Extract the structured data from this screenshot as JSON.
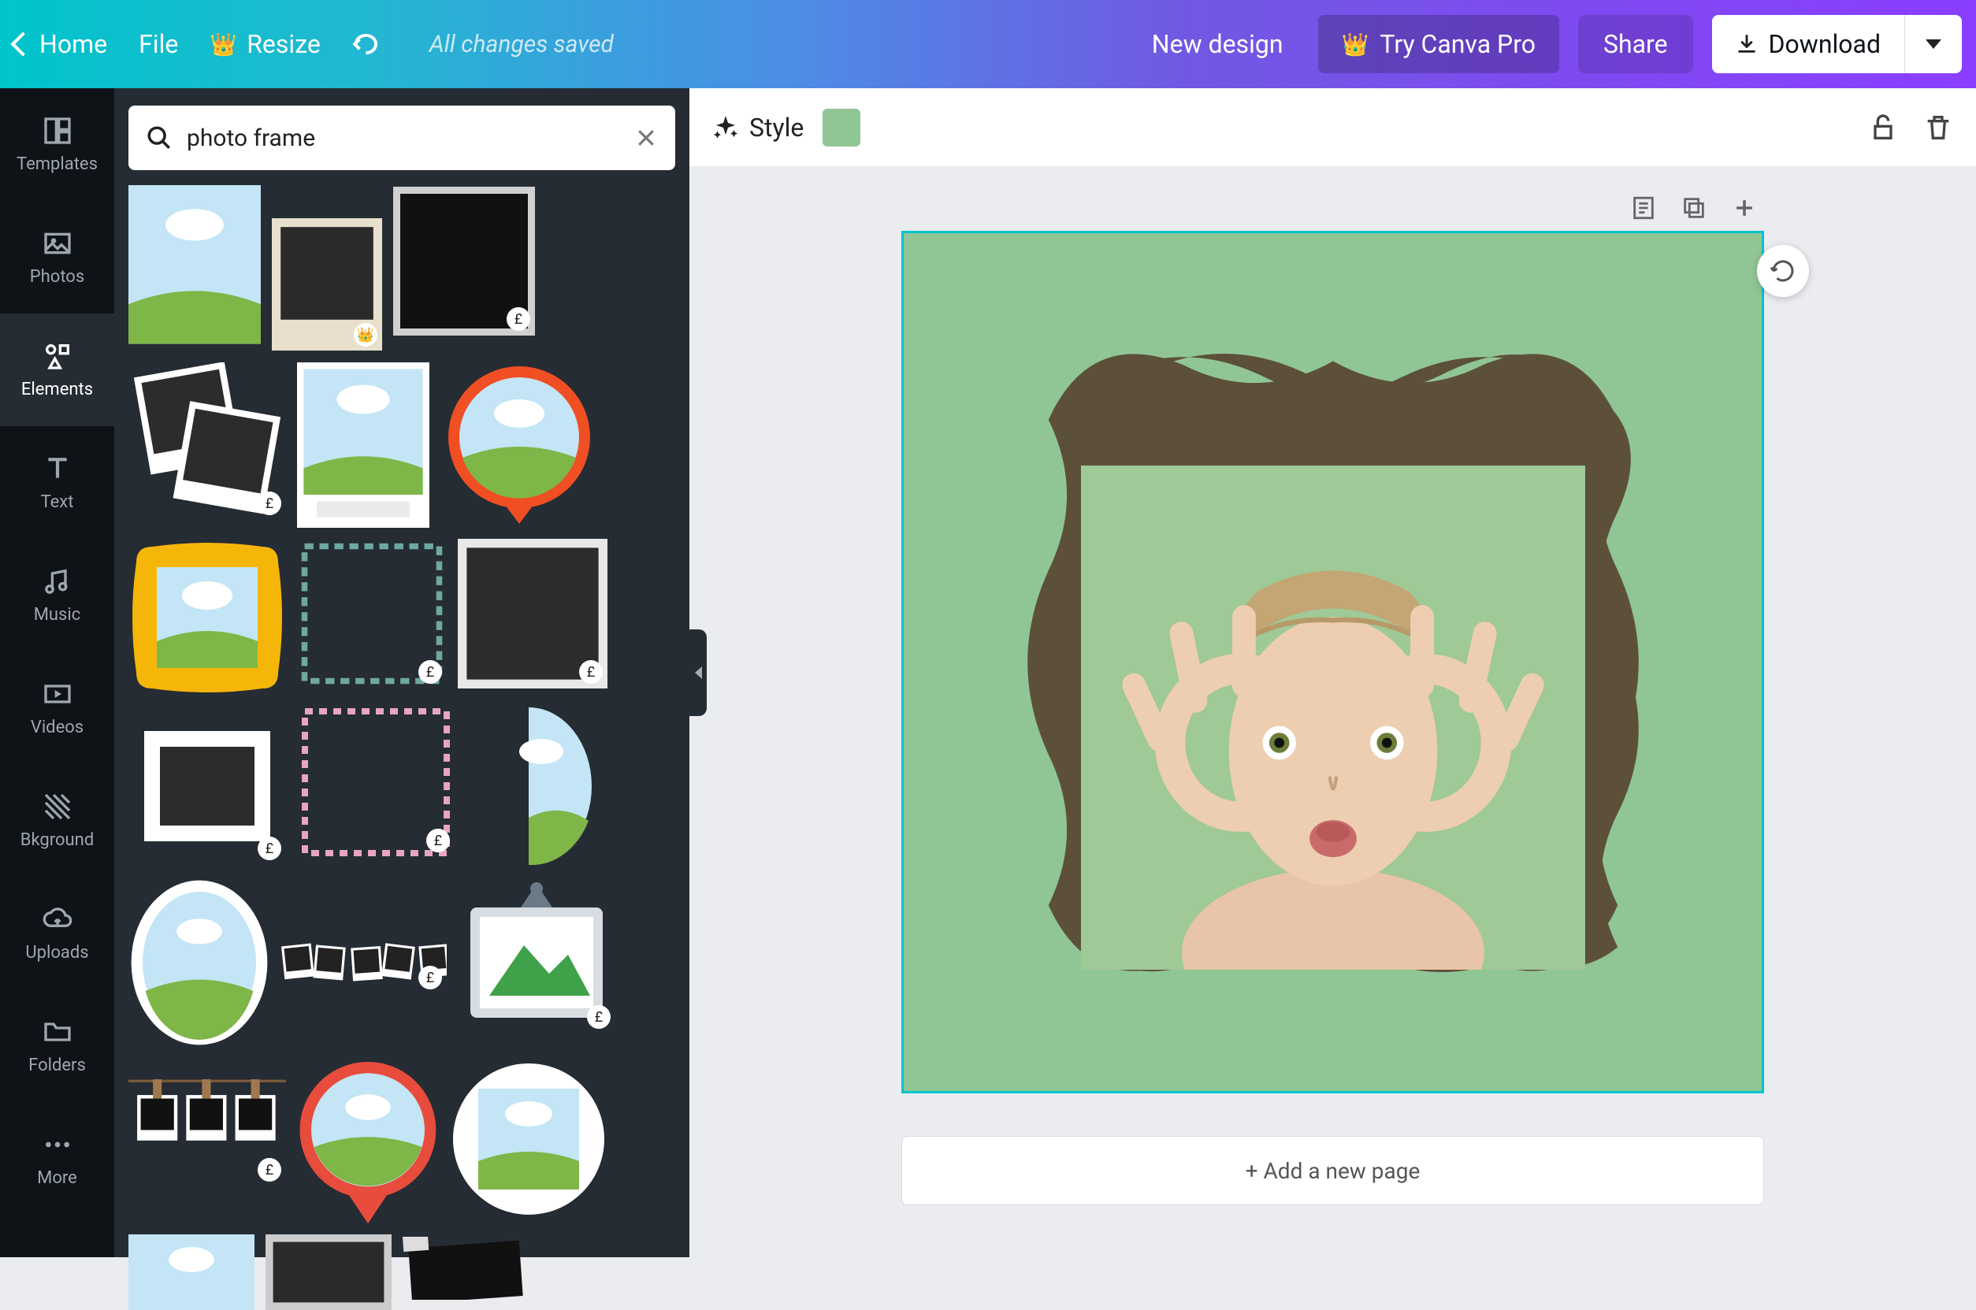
{
  "topbar": {
    "home": "Home",
    "file": "File",
    "resize": "Resize",
    "status": "All changes saved",
    "new_design": "New design",
    "try_pro": "Try Canva Pro",
    "share": "Share",
    "download": "Download"
  },
  "sidebar": {
    "items": [
      {
        "label": "Templates"
      },
      {
        "label": "Photos"
      },
      {
        "label": "Elements"
      },
      {
        "label": "Text"
      },
      {
        "label": "Music"
      },
      {
        "label": "Videos"
      },
      {
        "label": "Bkground"
      },
      {
        "label": "Uploads"
      },
      {
        "label": "Folders"
      },
      {
        "label": "More"
      }
    ]
  },
  "search": {
    "value": "photo frame",
    "placeholder": "Search"
  },
  "elements_panel": {
    "currency": "£",
    "crown": "👑"
  },
  "toolbar": {
    "style": "Style",
    "color": "#90c695"
  },
  "canvas": {
    "bg_color": "#90c695",
    "frame_color": "#5d503b",
    "add_page": "+ Add a new page"
  }
}
